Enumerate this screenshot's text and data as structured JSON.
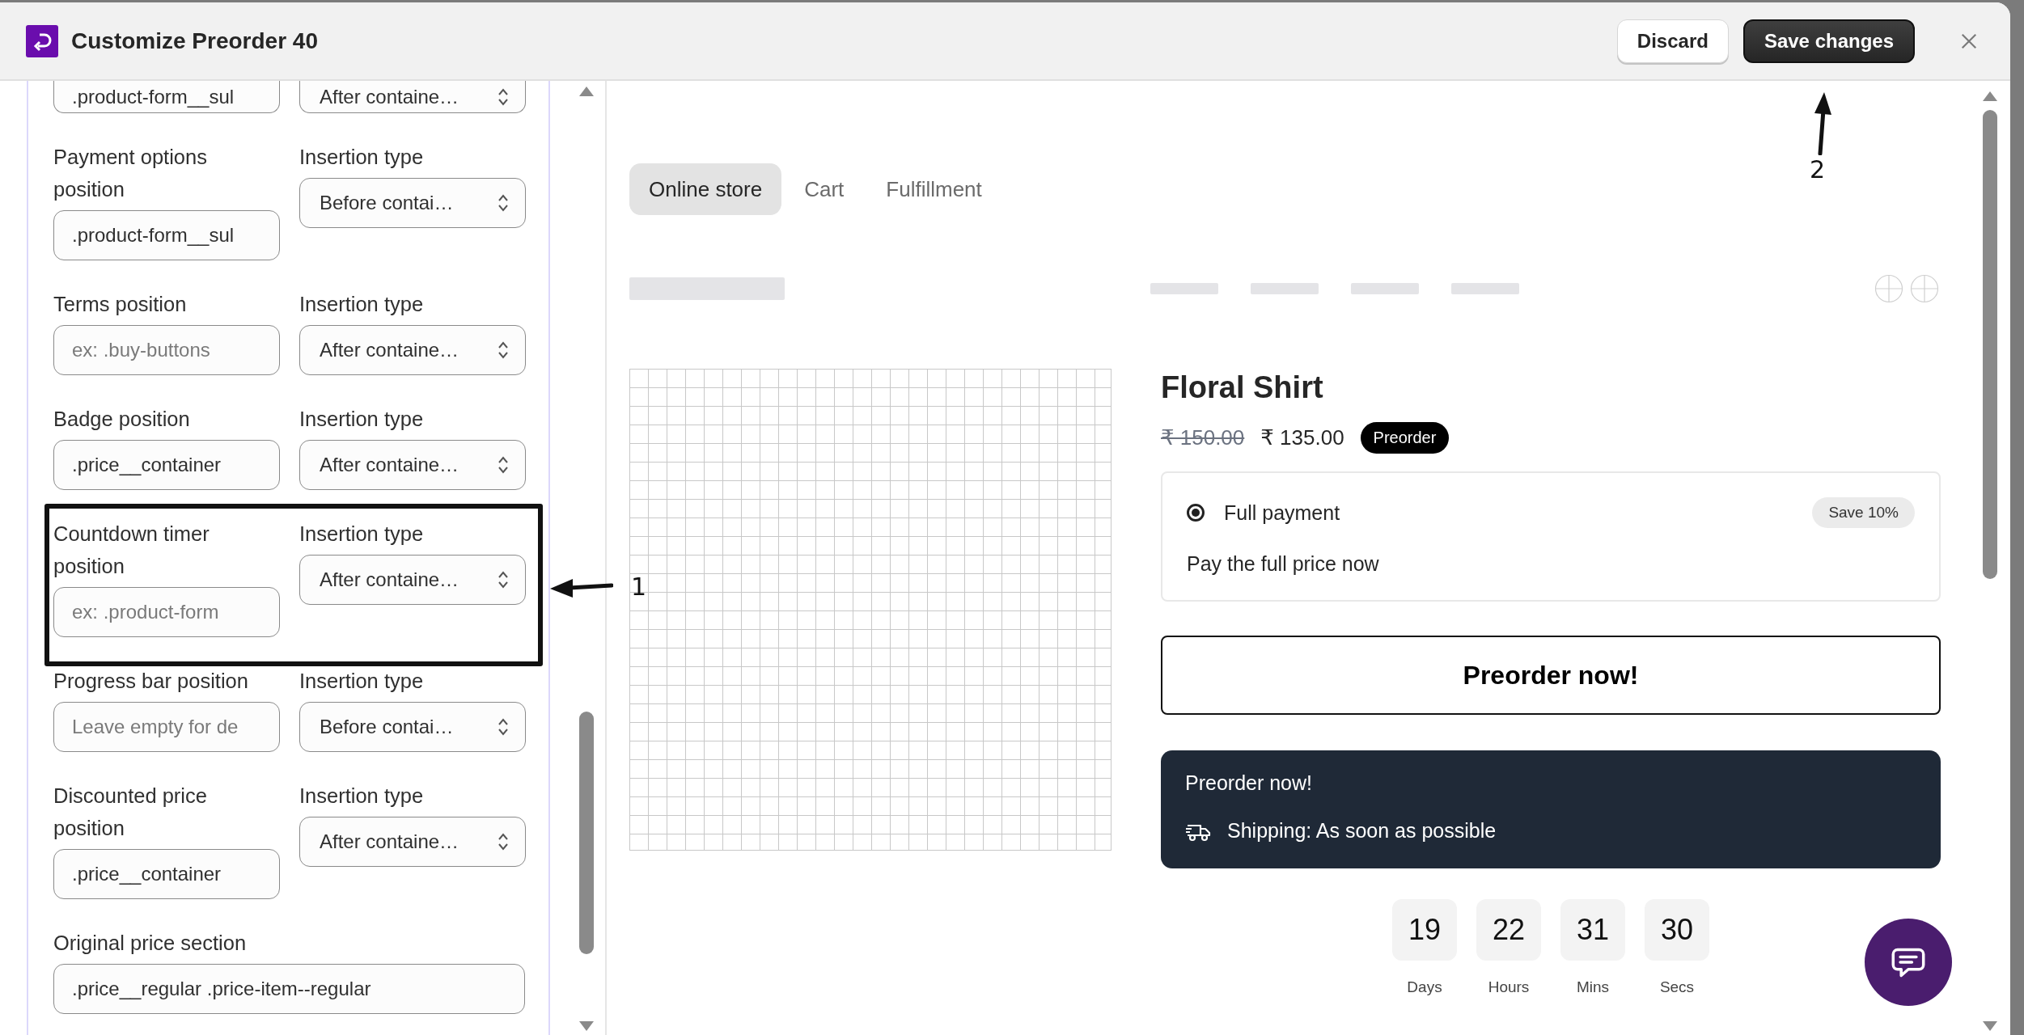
{
  "window": {
    "title": "Customize Preorder 40"
  },
  "header_buttons": [
    {
      "label": "Discard",
      "kind": "secondary"
    },
    {
      "label": "Save changes",
      "kind": "primary",
      "callout": "2"
    }
  ],
  "settings": [
    {
      "kind": "pair",
      "value": ".product-form__sul",
      "insertion_value": "After containe…",
      "highlighted": false
    },
    {
      "kind": "pair",
      "label": "Payment options position",
      "value": ".product-form__sul",
      "insertion_label": "Insertion type",
      "insertion_value": "Before contai…",
      "highlighted": false
    },
    {
      "kind": "pair",
      "label": "Terms position",
      "placeholder": "ex: .buy-buttons",
      "insertion_label": "Insertion type",
      "insertion_value": "After containe…",
      "highlighted": false
    },
    {
      "kind": "pair",
      "label": "Badge position",
      "value": ".price__container",
      "insertion_label": "Insertion type",
      "insertion_value": "After containe…",
      "highlighted": false
    },
    {
      "kind": "pair",
      "label": "Countdown timer position",
      "placeholder": "ex: .product-form",
      "insertion_label": "Insertion type",
      "insertion_value": "After containe…",
      "highlighted": true,
      "callout": "1"
    },
    {
      "kind": "pair",
      "label": "Progress bar position",
      "placeholder": "Leave empty for de",
      "insertion_label": "Insertion type",
      "insertion_value": "Before contai…",
      "highlighted": false
    },
    {
      "kind": "pair",
      "label": "Discounted price position",
      "value": ".price__container",
      "insertion_label": "Insertion type",
      "insertion_value": "After containe…",
      "highlighted": false
    },
    {
      "kind": "single",
      "label": "Original price section",
      "value": ".price__regular .price-item--regular",
      "highlighted": false
    }
  ],
  "preview": {
    "tabs": [
      {
        "label": "Online store",
        "selected": true
      },
      {
        "label": "Cart",
        "selected": false
      },
      {
        "label": "Fulfillment",
        "selected": false
      }
    ],
    "product": {
      "title": "Floral Shirt",
      "original_price": "₹ 150.00",
      "price": "₹ 135.00",
      "badge": "Preorder"
    },
    "payment_option": {
      "label": "Full payment",
      "selected": true,
      "tag": "Save 10%",
      "description": "Pay the full price now"
    },
    "button": "Preorder now!",
    "notice": {
      "title": "Preorder now!",
      "shipping": "Shipping: As soon as possible"
    },
    "countdown": [
      {
        "value": "19",
        "unit": "Days"
      },
      {
        "value": "22",
        "unit": "Hours"
      },
      {
        "value": "31",
        "unit": "Mins"
      },
      {
        "value": "30",
        "unit": "Secs"
      }
    ]
  }
}
